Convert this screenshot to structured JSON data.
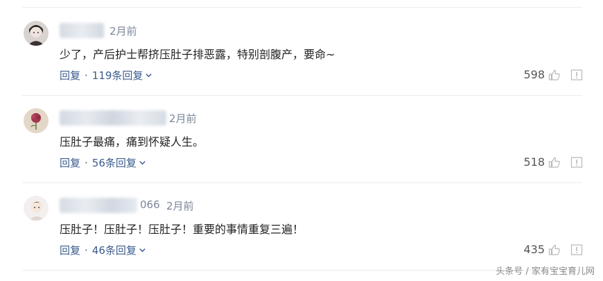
{
  "comments": [
    {
      "name_suffix": "",
      "time": "2月前",
      "content": "少了，产后护士帮挤压肚子排恶露，特别剖腹产，要命~",
      "reply_label": "回复",
      "reply_count": "119条回复",
      "likes": "598"
    },
    {
      "name_suffix": "",
      "time": "2月前",
      "content": "压肚子最痛，痛到怀疑人生。",
      "reply_label": "回复",
      "reply_count": "56条回复",
      "likes": "518"
    },
    {
      "name_suffix": "066",
      "time": "2月前",
      "content": "压肚子！压肚子！压肚子！重要的事情重复三遍！",
      "reply_label": "回复",
      "reply_count": "46条回复",
      "likes": "435"
    }
  ],
  "icons": {
    "like": "thumbs-up-icon",
    "report": "report-icon",
    "expand": "chevron-down-icon"
  },
  "watermark": "头条号 / 家有宝宝育儿网",
  "colors": {
    "link": "#3b5b8c",
    "meta": "#7a8599",
    "text": "#222222",
    "icon": "#b8b8b8"
  }
}
